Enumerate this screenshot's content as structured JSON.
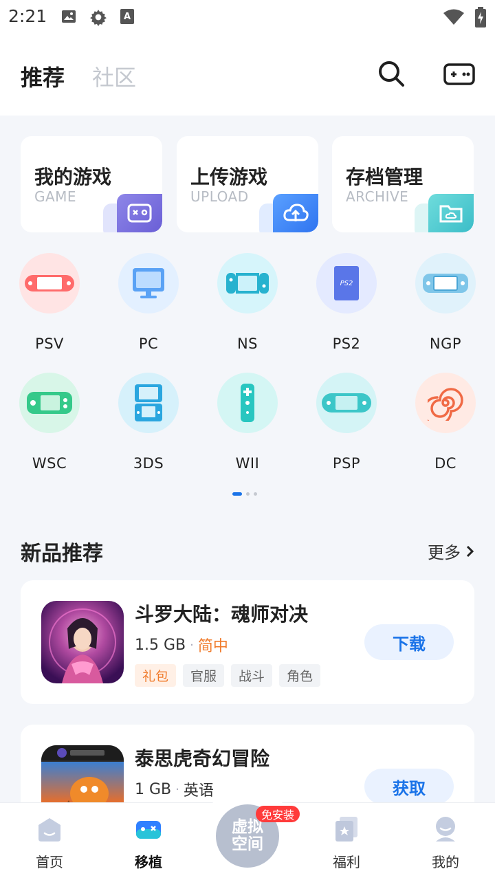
{
  "status_bar": {
    "time": "2:21"
  },
  "header": {
    "tabs": [
      {
        "label": "推荐"
      },
      {
        "label": "社区"
      }
    ]
  },
  "quick_cards": [
    {
      "title": "我的游戏",
      "subtitle": "GAME"
    },
    {
      "title": "上传游戏",
      "subtitle": "UPLOAD"
    },
    {
      "title": "存档管理",
      "subtitle": "ARCHIVE"
    }
  ],
  "platforms": [
    {
      "label": "PSV"
    },
    {
      "label": "PC"
    },
    {
      "label": "NS"
    },
    {
      "label": "PS2"
    },
    {
      "label": "NGP"
    },
    {
      "label": "WSC"
    },
    {
      "label": "3DS"
    },
    {
      "label": "WII"
    },
    {
      "label": "PSP"
    },
    {
      "label": "DC"
    }
  ],
  "ps2_badge_text": "PS2",
  "section": {
    "title": "新品推荐",
    "more": "更多"
  },
  "games": [
    {
      "name": "斗罗大陆：魂师对决",
      "size": "1.5 GB",
      "language": "简中",
      "tags": [
        "礼包",
        "官服",
        "战斗",
        "角色"
      ],
      "action": "下载"
    },
    {
      "name": "泰思虎奇幻冒险",
      "size": "1 GB",
      "language": "英语",
      "tags": [],
      "action": "获取"
    }
  ],
  "bottom_nav": {
    "items": [
      {
        "label": "首页"
      },
      {
        "label": "移植"
      },
      {
        "label": "福利"
      },
      {
        "label": "我的"
      }
    ],
    "center_label": "虚拟空间",
    "center_line1": "虚拟",
    "center_line2": "空间",
    "center_badge": "免安装"
  }
}
